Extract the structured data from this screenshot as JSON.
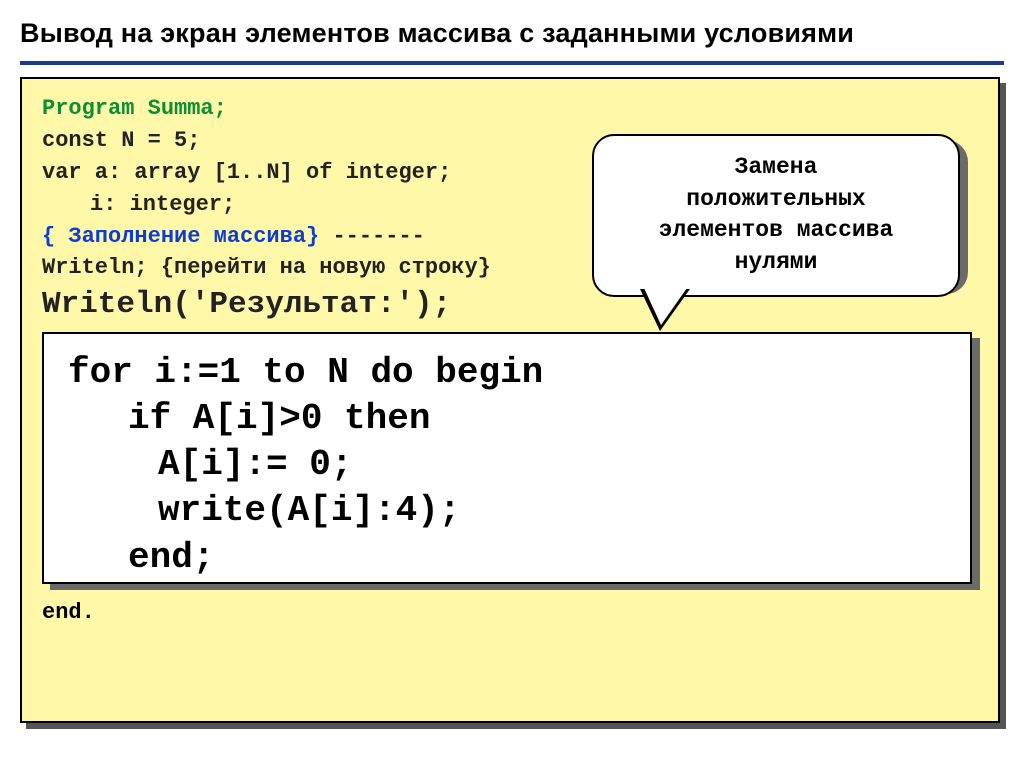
{
  "title": "Вывод на экран элементов массива с заданными условиями",
  "callout": {
    "line1": "Замена",
    "line2": "положительных",
    "line3": "элементов массива",
    "line4": "нулями"
  },
  "code": {
    "l1": "Program Summa;",
    "l2": "const N = 5;",
    "l3": "var a: array [1..N] of integer;",
    "l4": "i: integer;",
    "l5a": "{ Заполнение массива}",
    "l5b": " -------",
    "l6": "Writeln; {перейти на новую строку}",
    "l7": "Writeln('Результат:');",
    "end": "end."
  },
  "inner": {
    "l1": "for i:=1 to N do begin",
    "l2": "if A[i]>0 then",
    "l3": "A[i]:= 0;",
    "l4": "write(A[i]:4);",
    "l5": "end;"
  }
}
